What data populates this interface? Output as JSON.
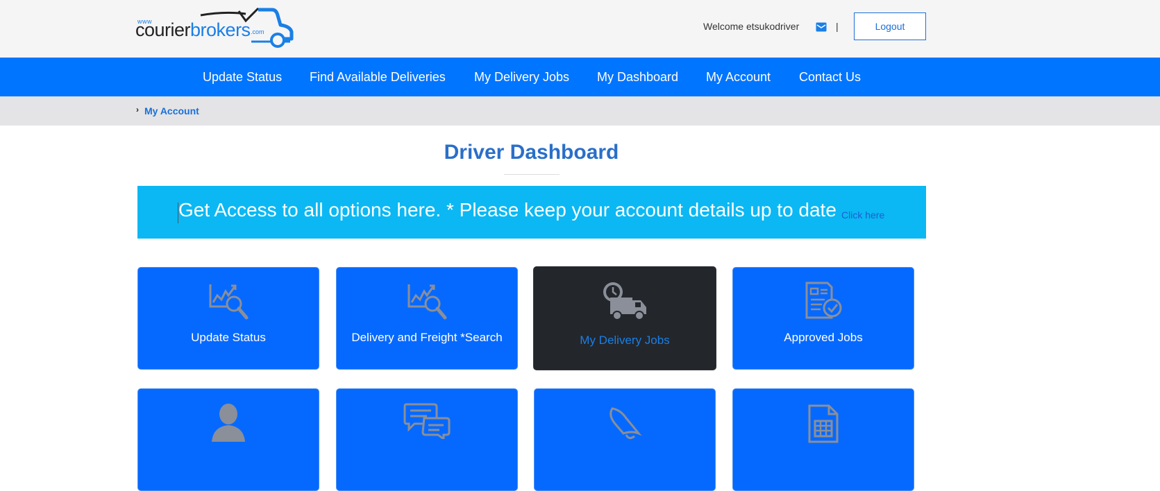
{
  "header": {
    "logo": {
      "www": "www",
      "courier": "courier",
      "brokers": "brokers",
      "com": ".com"
    },
    "welcome_text": "Welcome etsukodriver",
    "separator": "|",
    "logout_label": "Logout"
  },
  "nav": {
    "items": [
      {
        "label": "Update Status"
      },
      {
        "label": "Find Available Deliveries"
      },
      {
        "label": "My Delivery Jobs"
      },
      {
        "label": "My Dashboard"
      },
      {
        "label": "My Account"
      },
      {
        "label": "Contact Us"
      }
    ]
  },
  "breadcrumb": {
    "chevron": "›",
    "current": "My Account"
  },
  "page": {
    "title": "Driver Dashboard"
  },
  "banner": {
    "text": "Get Access to all options here. * Please keep your account details up to date",
    "link": "Click here"
  },
  "tiles": [
    {
      "label": "Update Status",
      "icon": "chart-search-icon"
    },
    {
      "label": "Delivery and Freight *Search",
      "icon": "chart-search-icon"
    },
    {
      "label": "My Delivery Jobs",
      "icon": "delivery-truck-clock-icon"
    },
    {
      "label": "Approved Jobs",
      "icon": "document-check-icon"
    },
    {
      "label": "",
      "icon": "user-icon"
    },
    {
      "label": "",
      "icon": "chat-bubbles-icon"
    },
    {
      "label": "",
      "icon": "bell-icon"
    },
    {
      "label": "",
      "icon": "spreadsheet-icon"
    }
  ],
  "colors": {
    "nav_blue": "#0075ff",
    "banner_cyan": "#0bb8f3",
    "tile_blue": "#0669ff",
    "tile_dark": "#23262b",
    "title_blue": "#2a6fc9"
  }
}
